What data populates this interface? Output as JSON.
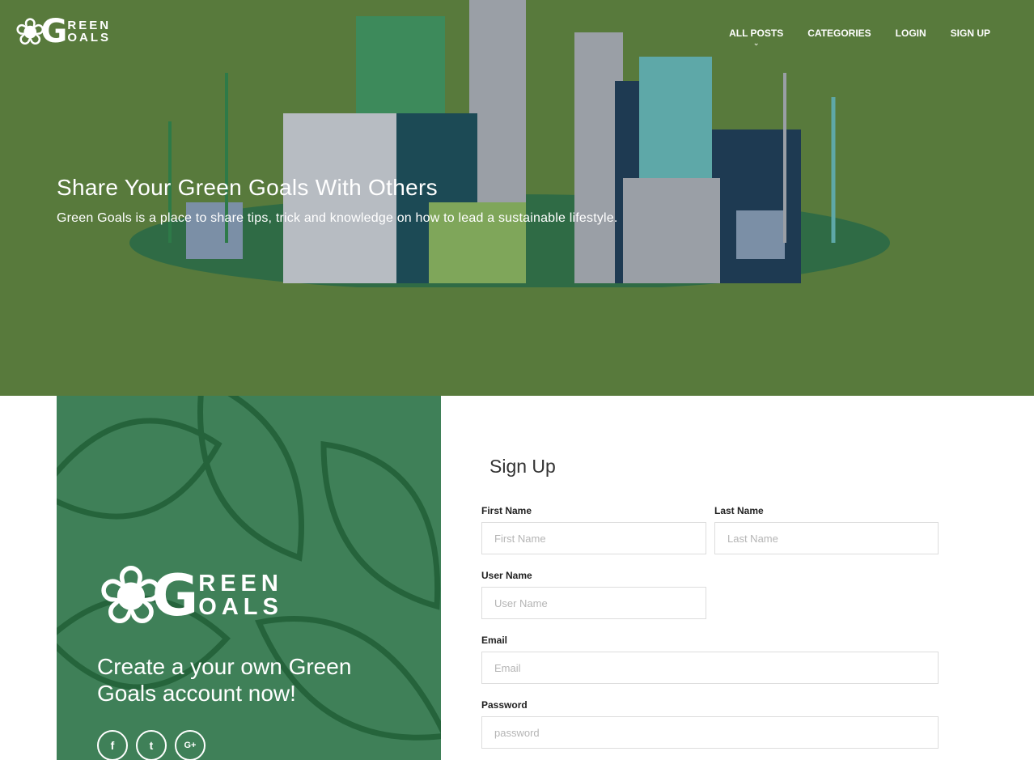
{
  "brand": {
    "logo_letter": "G",
    "logo_line1": "REEN",
    "logo_line2": "OALS"
  },
  "nav": {
    "items": [
      {
        "label": "ALL POSTS"
      },
      {
        "label": "CATEGORIES"
      },
      {
        "label": "LOGIN"
      },
      {
        "label": "SIGN UP"
      }
    ],
    "caret": "⌄"
  },
  "hero": {
    "title": "Share Your Green Goals With Others",
    "subtitle": "Green Goals is a place to share tips, trick and knowledge on how to lead a sustainable lifestyle."
  },
  "panel": {
    "heading": "Create a your own Green Goals account now!",
    "social": [
      {
        "icon": "f"
      },
      {
        "icon": "t"
      },
      {
        "icon": "G+"
      }
    ]
  },
  "form": {
    "title": "Sign Up",
    "first_name": {
      "label": "First Name",
      "placeholder": "First Name"
    },
    "last_name": {
      "label": "Last Name",
      "placeholder": "Last Name"
    },
    "user_name": {
      "label": "User Name",
      "placeholder": "User Name"
    },
    "email": {
      "label": "Email",
      "placeholder": "Email"
    },
    "password": {
      "label": "Password",
      "placeholder": "password"
    }
  },
  "colors": {
    "hero": "#587a3c",
    "panel": "#3f8058"
  }
}
